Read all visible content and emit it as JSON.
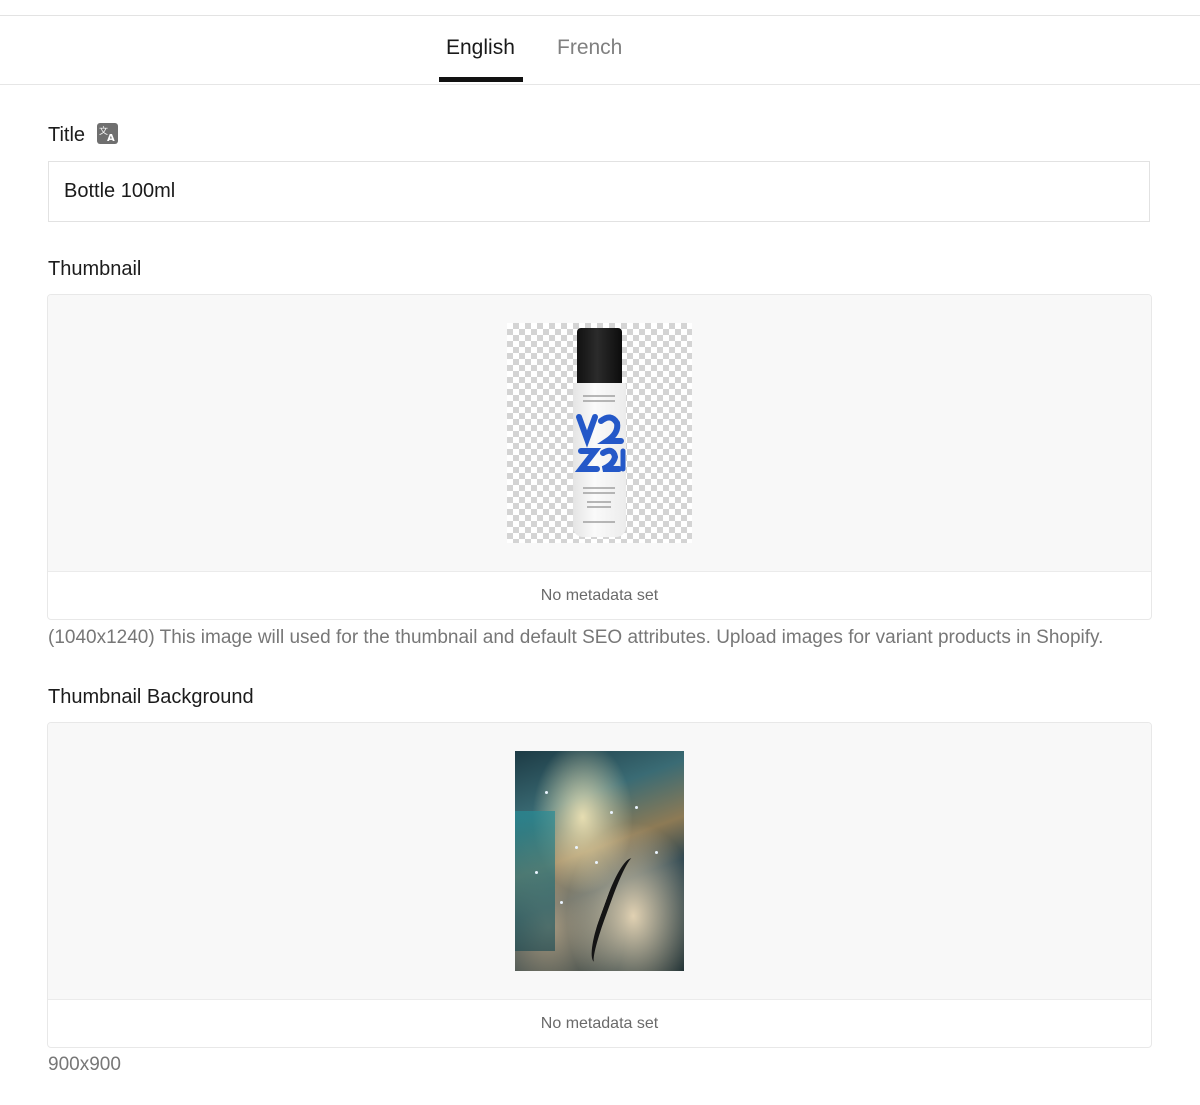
{
  "tabs": [
    {
      "label": "English",
      "active": true
    },
    {
      "label": "French",
      "active": false
    }
  ],
  "fields": {
    "title": {
      "label": "Title",
      "icon": "translate-icon",
      "value": "Bottle 100ml"
    },
    "thumbnail": {
      "label": "Thumbnail",
      "metadata": "No metadata set",
      "help": "(1040x1240) This image will used for the thumbnail and default SEO attributes. Upload images for variant products in Shopify."
    },
    "thumbnail_background": {
      "label": "Thumbnail Background",
      "metadata": "No metadata set",
      "help": "900x900"
    }
  },
  "colors": {
    "active_tab": "#1a1a1a",
    "inactive_tab": "#808080",
    "tab_underline": "#111111",
    "image_area": "#f8f8f8",
    "help_text": "#777777"
  }
}
